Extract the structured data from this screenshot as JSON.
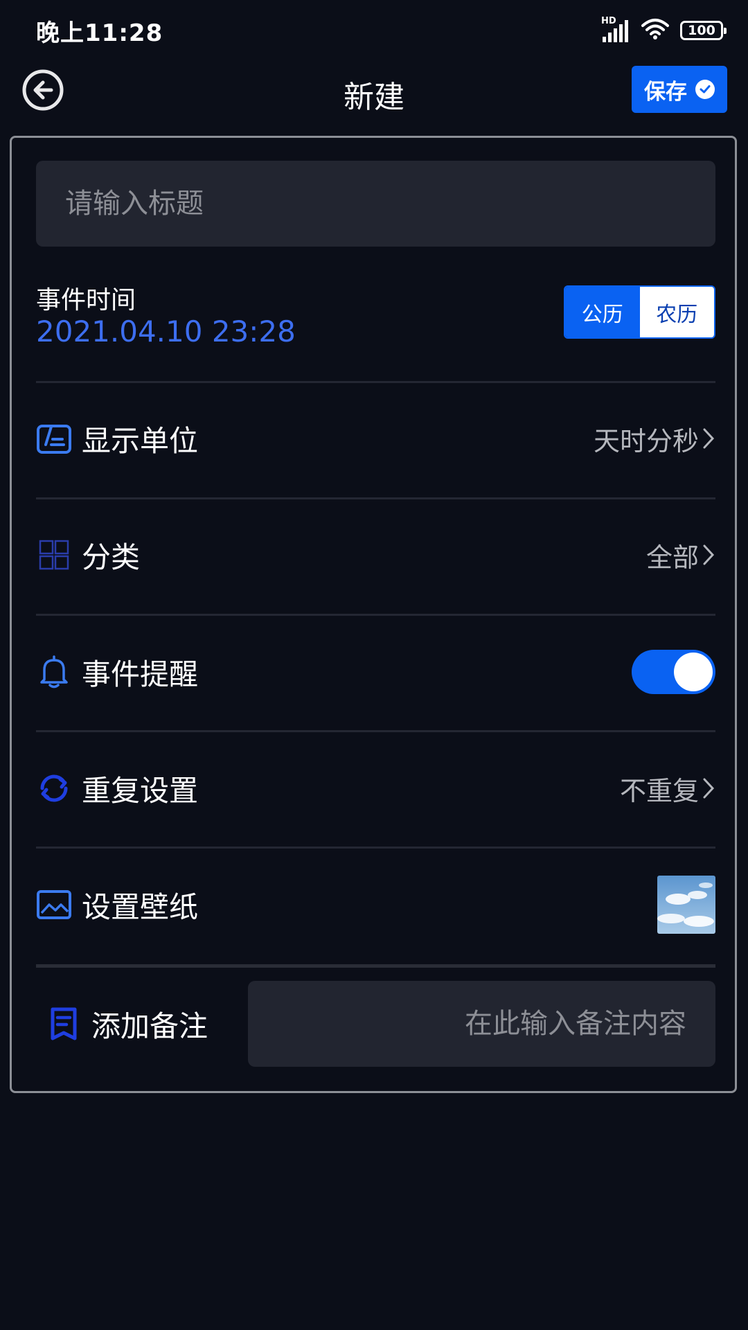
{
  "status_bar": {
    "time": "晚上11:28",
    "network_tag": "HD",
    "battery_level": "100"
  },
  "header": {
    "title": "新建",
    "save_label": "保存"
  },
  "form": {
    "title_placeholder": "请输入标题",
    "event_time_label": "事件时间",
    "event_time_value": "2021.04.10 23:28",
    "calendar_options": [
      "公历",
      "农历"
    ],
    "calendar_selected": "公历",
    "rows": [
      {
        "label": "显示单位",
        "value": "天时分秒",
        "icon": "display-unit-icon"
      },
      {
        "label": "分类",
        "value": "全部",
        "icon": "grid-icon"
      },
      {
        "label": "事件提醒",
        "toggle_on": true,
        "icon": "bell-icon"
      },
      {
        "label": "重复设置",
        "value": "不重复",
        "icon": "repeat-icon"
      },
      {
        "label": "设置壁纸",
        "icon": "image-icon"
      }
    ],
    "note_label": "添加备注",
    "note_placeholder": "在此输入备注内容"
  },
  "colors": {
    "background": "#0b0e18",
    "accent": "#0a62f2",
    "date_text": "#3d6ef0",
    "input_bg": "#222530"
  }
}
